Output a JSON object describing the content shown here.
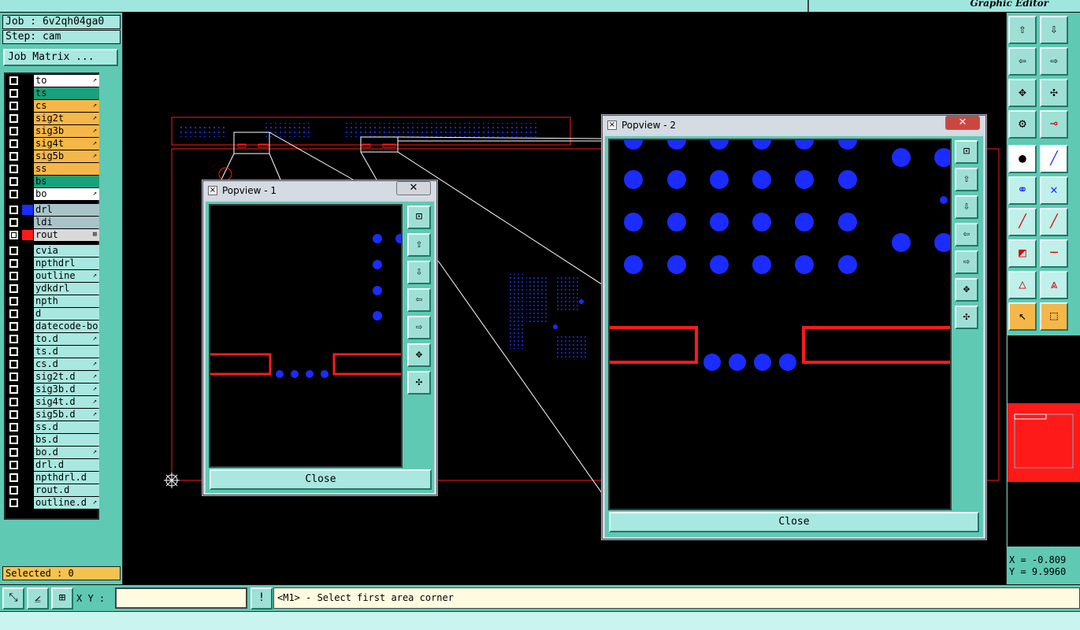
{
  "app": {
    "title": "Graphic Editor"
  },
  "job": {
    "job_label": "Job : 6v2qh04ga0",
    "step_label": "Step: cam",
    "matrix_button": "Job Matrix ..."
  },
  "layers": [
    {
      "name": "to",
      "color": "#ffffff",
      "swatch": "#000000",
      "checked": false,
      "mark": "↗"
    },
    {
      "name": "ts",
      "color": "#1aa07a",
      "swatch": "#000000",
      "checked": false,
      "mark": ""
    },
    {
      "name": "cs",
      "color": "#f5b74a",
      "swatch": "#000000",
      "checked": false,
      "mark": "↗"
    },
    {
      "name": "sig2t",
      "color": "#f5b74a",
      "swatch": "#000000",
      "checked": false,
      "mark": "↗"
    },
    {
      "name": "sig3b",
      "color": "#f5b74a",
      "swatch": "#000000",
      "checked": false,
      "mark": "↗"
    },
    {
      "name": "sig4t",
      "color": "#f5b74a",
      "swatch": "#000000",
      "checked": false,
      "mark": "↗"
    },
    {
      "name": "sig5b",
      "color": "#f5b74a",
      "swatch": "#000000",
      "checked": false,
      "mark": "↗"
    },
    {
      "name": "ss",
      "color": "#f5b74a",
      "swatch": "#000000",
      "checked": false,
      "mark": ""
    },
    {
      "name": "bs",
      "color": "#1aa07a",
      "swatch": "#000000",
      "checked": false,
      "mark": ""
    },
    {
      "name": "bo",
      "color": "#ffffff",
      "swatch": "#000000",
      "checked": false,
      "mark": "↗"
    },
    {
      "name": "drl",
      "color": "#a9c4c8",
      "swatch": "#1a2cff",
      "checked": false,
      "mark": ""
    },
    {
      "name": "ldi",
      "color": "#a9c4c8",
      "swatch": "#000000",
      "checked": false,
      "mark": ""
    },
    {
      "name": "rout",
      "color": "#d9d9d9",
      "swatch": "#ff1a1a",
      "checked": true,
      "mark": "⊞"
    },
    {
      "name": "cvia",
      "color": "#a8e8e0",
      "swatch": "#000000",
      "checked": false,
      "mark": ""
    },
    {
      "name": "npthdrl",
      "color": "#a8e8e0",
      "swatch": "#000000",
      "checked": false,
      "mark": ""
    },
    {
      "name": "outline",
      "color": "#a8e8e0",
      "swatch": "#000000",
      "checked": false,
      "mark": "↗"
    },
    {
      "name": "ydkdrl",
      "color": "#a8e8e0",
      "swatch": "#000000",
      "checked": false,
      "mark": ""
    },
    {
      "name": "npth",
      "color": "#a8e8e0",
      "swatch": "#000000",
      "checked": false,
      "mark": ""
    },
    {
      "name": "d",
      "color": "#a8e8e0",
      "swatch": "#000000",
      "checked": false,
      "mark": ""
    },
    {
      "name": "datecode-bo",
      "color": "#a8e8e0",
      "swatch": "#000000",
      "checked": false,
      "mark": ""
    },
    {
      "name": "to.d",
      "color": "#a8e8e0",
      "swatch": "#000000",
      "checked": false,
      "mark": "↗"
    },
    {
      "name": "ts.d",
      "color": "#a8e8e0",
      "swatch": "#000000",
      "checked": false,
      "mark": ""
    },
    {
      "name": "cs.d",
      "color": "#a8e8e0",
      "swatch": "#000000",
      "checked": false,
      "mark": "↗"
    },
    {
      "name": "sig2t.d",
      "color": "#a8e8e0",
      "swatch": "#000000",
      "checked": false,
      "mark": "↗"
    },
    {
      "name": "sig3b.d",
      "color": "#a8e8e0",
      "swatch": "#000000",
      "checked": false,
      "mark": "↗"
    },
    {
      "name": "sig4t.d",
      "color": "#a8e8e0",
      "swatch": "#000000",
      "checked": false,
      "mark": "↗"
    },
    {
      "name": "sig5b.d",
      "color": "#a8e8e0",
      "swatch": "#000000",
      "checked": false,
      "mark": "↗"
    },
    {
      "name": "ss.d",
      "color": "#a8e8e0",
      "swatch": "#000000",
      "checked": false,
      "mark": ""
    },
    {
      "name": "bs.d",
      "color": "#a8e8e0",
      "swatch": "#000000",
      "checked": false,
      "mark": ""
    },
    {
      "name": "bo.d",
      "color": "#a8e8e0",
      "swatch": "#000000",
      "checked": false,
      "mark": "↗"
    },
    {
      "name": "drl.d",
      "color": "#a8e8e0",
      "swatch": "#000000",
      "checked": false,
      "mark": ""
    },
    {
      "name": "npthdrl.d",
      "color": "#a8e8e0",
      "swatch": "#000000",
      "checked": false,
      "mark": ""
    },
    {
      "name": "rout.d",
      "color": "#a8e8e0",
      "swatch": "#000000",
      "checked": false,
      "mark": ""
    },
    {
      "name": "outline.d",
      "color": "#a8e8e0",
      "swatch": "#000000",
      "checked": false,
      "mark": "↗"
    }
  ],
  "selected": {
    "label": "Selected : 0"
  },
  "popview1": {
    "title": "Popview - 1",
    "close_label": "Close",
    "x_glyph": "✕"
  },
  "popview2": {
    "title": "Popview - 2",
    "close_label": "Close",
    "x_glyph": "✕"
  },
  "coords": {
    "x": "X = -0.809",
    "y": "Y = 9.9960"
  },
  "bottom": {
    "xy_label": "X Y :",
    "xy_value": "",
    "prompt": "<M1> - Select first area corner",
    "alert_glyph": "!"
  },
  "colors": {
    "accent": "#5fc9b3",
    "pad_blue": "#1a2cff",
    "rout_red": "#ff1a1a",
    "selected_bg": "#f5c24f"
  }
}
